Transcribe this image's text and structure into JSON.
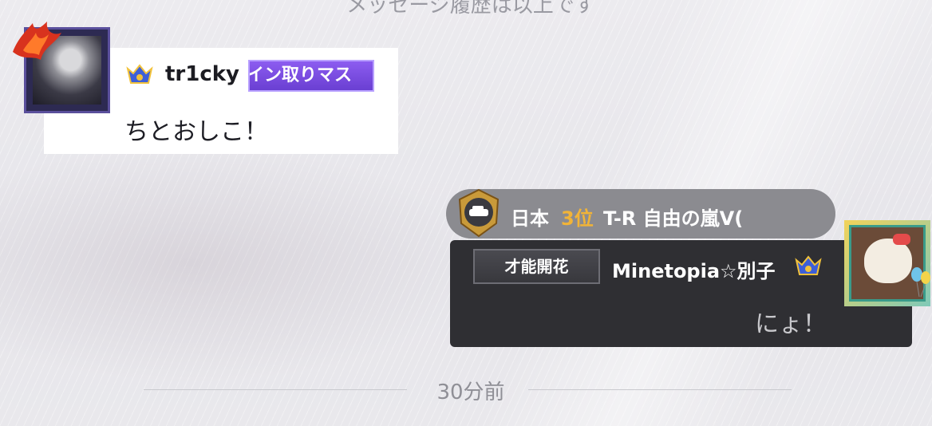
{
  "system": {
    "top_notice": "メッセージ履歴は以上です"
  },
  "messages": [
    {
      "side": "left",
      "avatar_icon": "spiky-hair-avatar-icon",
      "crest_icon": "rank-crest-icon",
      "username": "tr1cky",
      "title_tag": "イン取りマス",
      "text": "ちとおしこ！"
    },
    {
      "side": "right",
      "ranking": {
        "medal_icon": "car-medal-icon",
        "country": "日本",
        "position": "3位",
        "title": "T-R 自由の嵐V("
      },
      "title_tag": "才能開花",
      "username": "Minetopia☆別子",
      "crest_icon": "rank-crest-icon",
      "avatar_icon": "kitty-avatar-icon",
      "text": "にょ！"
    }
  ],
  "divider": {
    "time": "30分前"
  },
  "colors": {
    "left_tag": "#7a4fe0",
    "rank_gold": "#f2b437",
    "right_bubble": "#2f2f33",
    "rank_pill": "#8b8b90"
  }
}
